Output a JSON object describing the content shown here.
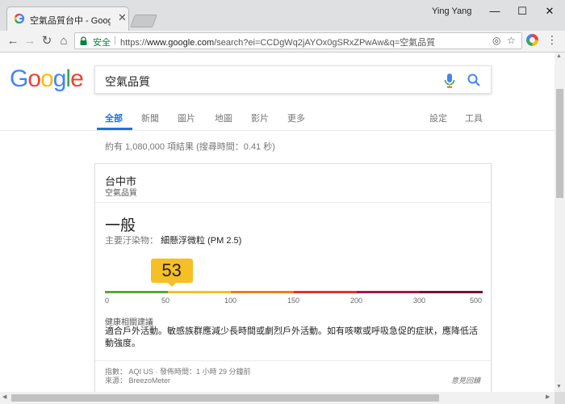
{
  "browser": {
    "tab_title": "空氣品質台中 - Google 搜",
    "user_name": "Ying Yang",
    "window_controls": {
      "minimize": "—",
      "maximize": "☐",
      "close": "✕"
    },
    "secure_label": "安全",
    "url_prefix": "https://",
    "url_host": "www.google.com",
    "url_path": "/search?ei=CCDgWq2jAYOx0gSRxZPwAw&q=空氣品質",
    "icons": [
      "back-icon",
      "forward-icon",
      "reload-icon",
      "home-icon",
      "lock-icon",
      "location-icon",
      "star-icon",
      "extension-icon",
      "menu-icon"
    ]
  },
  "google": {
    "logo": [
      "G",
      "o",
      "o",
      "g",
      "l",
      "e"
    ],
    "logo_colors": [
      "#4285f4",
      "#ea4335",
      "#fbbc05",
      "#4285f4",
      "#34a853",
      "#ea4335"
    ],
    "query": "空氣品質",
    "tabs": [
      {
        "label": "全部",
        "active": true
      },
      {
        "label": "新聞",
        "active": false
      },
      {
        "label": "圖片",
        "active": false
      },
      {
        "label": "地圖",
        "active": false
      },
      {
        "label": "影片",
        "active": false
      },
      {
        "label": "更多",
        "active": false
      }
    ],
    "settings_label": "設定",
    "tools_label": "工具",
    "result_stats": "約有 1,080,000 項結果 (搜尋時間：0.41 秒)"
  },
  "aqi_card": {
    "city": "台中市",
    "subtitle": "空氣品質",
    "level": "一般",
    "pollutant_label": "主要汙染物：",
    "pollutant": "細懸浮微粒 (PM 2.5)",
    "aqi_value": 53,
    "scale_ticks": [
      "0",
      "50",
      "100",
      "150",
      "200",
      "300",
      "500"
    ],
    "scale_colors": [
      "#5aa63b",
      "#f6bf26",
      "#ef7d1b",
      "#e2332c",
      "#a3174e",
      "#7a1030"
    ],
    "health_title": "健康相關建議",
    "health_text": "適合戶外活動。敏感族群應減少長時間或劇烈戶外活動。如有咳嗽或呼吸急促的症狀，應降低活動強度。",
    "index_line": "指數： AQI US · 發佈時間：1 小時 29 分鐘前",
    "source_line": "來源： BreezoMeter",
    "feedback": "意見回饋"
  },
  "colors": {
    "accent": "#1a73e8",
    "secure": "#0b8043"
  }
}
